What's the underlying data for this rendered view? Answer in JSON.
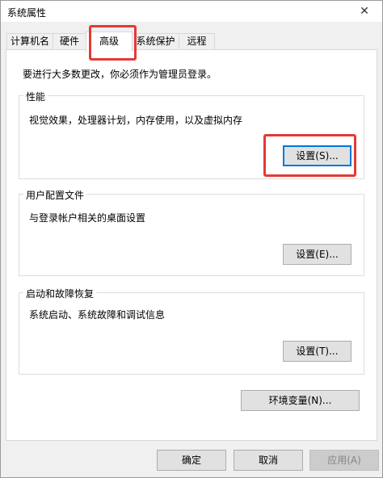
{
  "window": {
    "title": "系统属性",
    "close_glyph": "✕"
  },
  "tabs": [
    {
      "label": "计算机名"
    },
    {
      "label": "硬件"
    },
    {
      "label": "高级"
    },
    {
      "label": "系统保护"
    },
    {
      "label": "远程"
    }
  ],
  "intro": "要进行大多数更改，你必须作为管理员登录。",
  "performance": {
    "title": "性能",
    "desc": "视觉效果，处理器计划，内存使用，以及虚拟内存",
    "button": "设置(S)..."
  },
  "profile": {
    "title": "用户配置文件",
    "desc": "与登录帐户相关的桌面设置",
    "button": "设置(E)..."
  },
  "startup": {
    "title": "启动和故障恢复",
    "desc": "系统启动、系统故障和调试信息",
    "button": "设置(T)..."
  },
  "env_button": "环境变量(N)...",
  "footer": {
    "ok": "确定",
    "cancel": "取消",
    "apply": "应用(A)"
  },
  "colors": {
    "highlight": "#e53935",
    "focus": "#0078d7"
  }
}
